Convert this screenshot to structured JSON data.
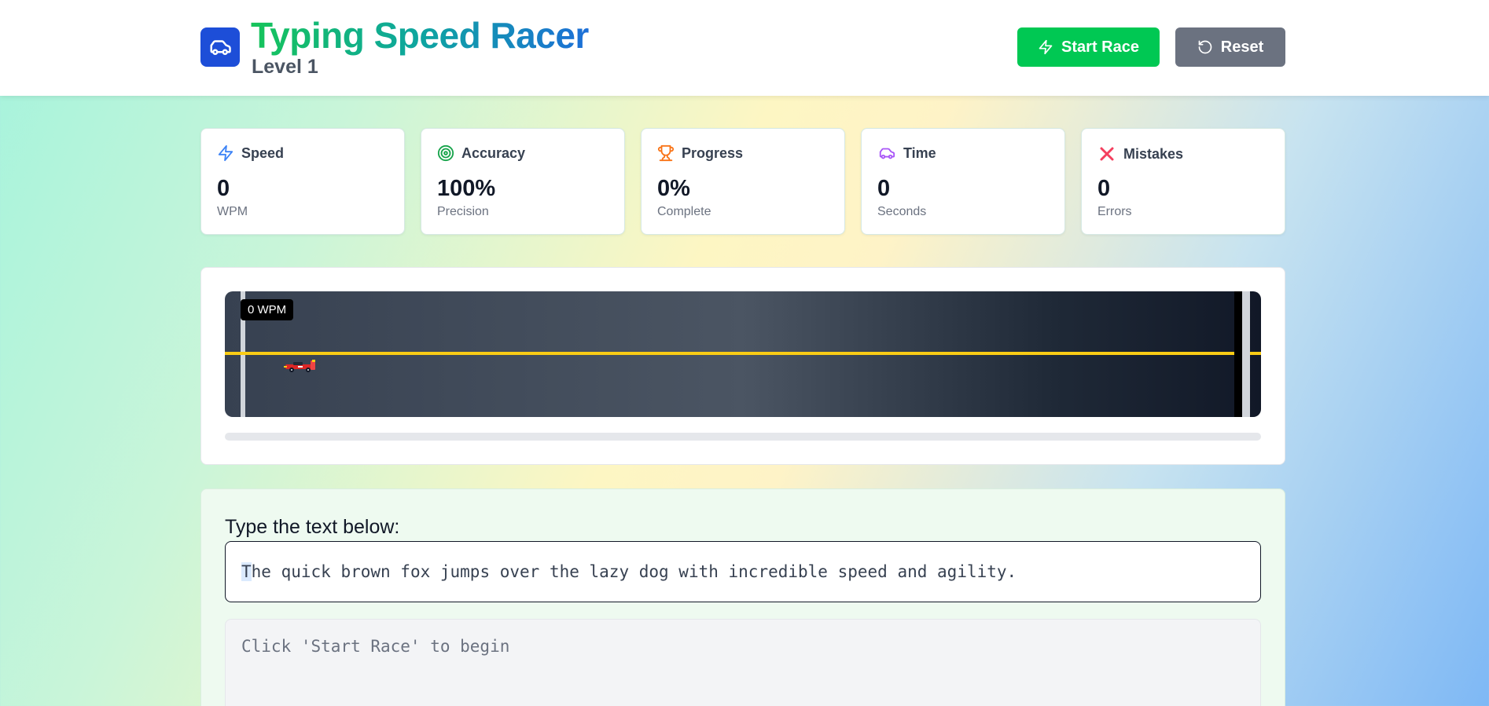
{
  "header": {
    "title": "Typing Speed Racer",
    "level": "Level 1",
    "start_label": "Start Race",
    "reset_label": "Reset"
  },
  "stats": [
    {
      "label": "Speed",
      "value": "0",
      "unit": "WPM",
      "icon": "lightning-icon",
      "color": "#3b82f6"
    },
    {
      "label": "Accuracy",
      "value": "100%",
      "unit": "Precision",
      "icon": "target-icon",
      "color": "#16a34a"
    },
    {
      "label": "Progress",
      "value": "0%",
      "unit": "Complete",
      "icon": "trophy-icon",
      "color": "#f97316"
    },
    {
      "label": "Time",
      "value": "0",
      "unit": "Seconds",
      "icon": "car-icon",
      "color": "#a855f7"
    },
    {
      "label": "Mistakes",
      "value": "0",
      "unit": "Errors",
      "icon": "close-icon",
      "color": "#f43f5e"
    }
  ],
  "race": {
    "wpm_tag": "0 WPM",
    "progress_percent": 0
  },
  "typing": {
    "label": "Type the text below:",
    "sample_first": "T",
    "sample_rest": "he quick brown fox jumps over the lazy dog with incredible speed and agility.",
    "input_placeholder": "Click 'Start Race' to begin",
    "input_value": ""
  },
  "colors": {
    "primary": "#1d4ed8",
    "start_button": "#00c853",
    "reset_button": "#6b7280",
    "lane_line": "#facc15"
  }
}
